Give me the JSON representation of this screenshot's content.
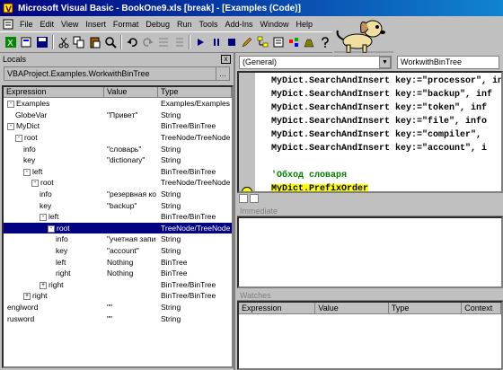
{
  "titlebar": {
    "title": "Microsoft Visual Basic - BookOne9.xls [break] - [Examples (Code)]"
  },
  "menu": [
    "File",
    "Edit",
    "View",
    "Insert",
    "Format",
    "Debug",
    "Run",
    "Tools",
    "Add-Ins",
    "Window",
    "Help"
  ],
  "locals": {
    "header": "Locals",
    "close": "x",
    "context": "VBAProject.Examples.WorkwithBinTree",
    "columns": [
      "Expression",
      "Value",
      "Type"
    ],
    "rows": [
      {
        "expr": "Examples",
        "value": "",
        "type": "Examples/Examples",
        "depth": 0,
        "toggle": "-"
      },
      {
        "expr": "GlobeVar",
        "value": "\"Привет\"",
        "type": "String",
        "depth": 1,
        "toggle": ""
      },
      {
        "expr": "MyDict",
        "value": "",
        "type": "BinTree/BinTree",
        "depth": 0,
        "toggle": "-"
      },
      {
        "expr": "root",
        "value": "",
        "type": "TreeNode/TreeNode",
        "depth": 1,
        "toggle": "-"
      },
      {
        "expr": "info",
        "value": "\"словарь\"",
        "type": "String",
        "depth": 2,
        "toggle": ""
      },
      {
        "expr": "key",
        "value": "\"dictionary\"",
        "type": "String",
        "depth": 2,
        "toggle": ""
      },
      {
        "expr": "left",
        "value": "",
        "type": "BinTree/BinTree",
        "depth": 2,
        "toggle": "-"
      },
      {
        "expr": "root",
        "value": "",
        "type": "TreeNode/TreeNode",
        "depth": 3,
        "toggle": "-"
      },
      {
        "expr": "info",
        "value": "\"резервная ко",
        "type": "String",
        "depth": 4,
        "toggle": ""
      },
      {
        "expr": "key",
        "value": "\"backup\"",
        "type": "String",
        "depth": 4,
        "toggle": ""
      },
      {
        "expr": "left",
        "value": "",
        "type": "BinTree/BinTree",
        "depth": 4,
        "toggle": "-"
      },
      {
        "expr": "root",
        "value": "",
        "type": "TreeNode/TreeNode",
        "depth": 5,
        "toggle": "-",
        "selected": true
      },
      {
        "expr": "info",
        "value": "\"учетная запи",
        "type": "String",
        "depth": 6,
        "toggle": ""
      },
      {
        "expr": "key",
        "value": "\"account\"",
        "type": "String",
        "depth": 6,
        "toggle": ""
      },
      {
        "expr": "left",
        "value": "Nothing",
        "type": "BinTree",
        "depth": 6,
        "toggle": ""
      },
      {
        "expr": "right",
        "value": "Nothing",
        "type": "BinTree",
        "depth": 6,
        "toggle": ""
      },
      {
        "expr": "right",
        "value": "",
        "type": "BinTree/BinTree",
        "depth": 4,
        "toggle": "+"
      },
      {
        "expr": "right",
        "value": "",
        "type": "BinTree/BinTree",
        "depth": 2,
        "toggle": "+"
      },
      {
        "expr": "englword",
        "value": "\"\"",
        "type": "String",
        "depth": 0,
        "toggle": ""
      },
      {
        "expr": "rusword",
        "value": "\"\"",
        "type": "String",
        "depth": 0,
        "toggle": ""
      }
    ]
  },
  "code": {
    "object_combo": "(General)",
    "proc_combo": "WorkwithBinTree",
    "lines": [
      {
        "text": "MyDict.SearchAndInsert key:=\"processor\", in",
        "cls": ""
      },
      {
        "text": "MyDict.SearchAndInsert key:=\"backup\", inf",
        "cls": ""
      },
      {
        "text": "MyDict.SearchAndInsert key:=\"token\", inf",
        "cls": ""
      },
      {
        "text": "MyDict.SearchAndInsert key:=\"file\", info",
        "cls": ""
      },
      {
        "text": "MyDict.SearchAndInsert key:=\"compiler\",",
        "cls": ""
      },
      {
        "text": "MyDict.SearchAndInsert key:=\"account\", i",
        "cls": ""
      },
      {
        "text": "",
        "cls": ""
      },
      {
        "text": "'Обход словаря",
        "cls": "comment"
      },
      {
        "text": "MyDict.PrefixOrder",
        "cls": "current"
      }
    ]
  },
  "immediate": {
    "title": "Immediate"
  },
  "watches": {
    "title": "Watches",
    "columns": [
      "Expression",
      "Value",
      "Type",
      "Context"
    ]
  },
  "colors": {
    "title_start": "#000080",
    "title_end": "#1084d0",
    "selection": "#000080",
    "exec": "#ffff00"
  }
}
